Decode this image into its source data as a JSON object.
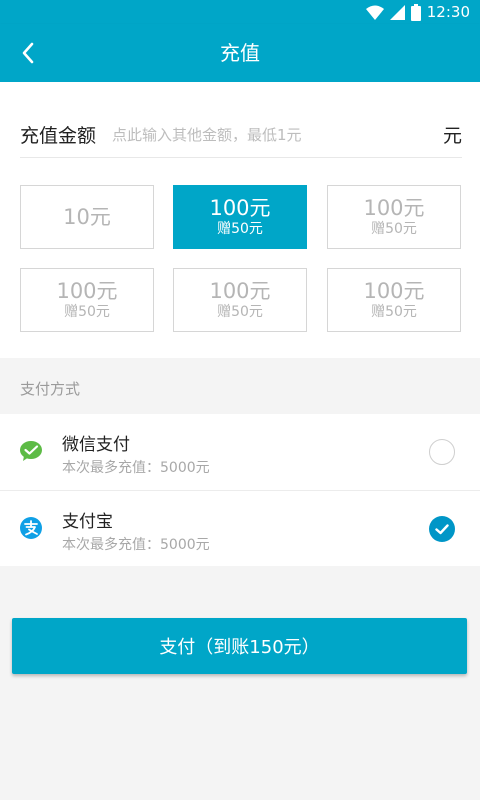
{
  "status_bar": {
    "time": "12:30",
    "icons": [
      "wifi-icon",
      "signal-icon",
      "battery-icon"
    ]
  },
  "app_bar": {
    "title": "充值",
    "back_icon": "chevron-left-icon"
  },
  "amount": {
    "label": "充值金额",
    "placeholder": "点此输入其他金额，最低1元",
    "value": "",
    "unit": "元"
  },
  "options": [
    {
      "amount": "10元",
      "bonus": "",
      "selected": false
    },
    {
      "amount": "100元",
      "bonus": "赠50元",
      "selected": true
    },
    {
      "amount": "100元",
      "bonus": "赠50元",
      "selected": false
    },
    {
      "amount": "100元",
      "bonus": "赠50元",
      "selected": false
    },
    {
      "amount": "100元",
      "bonus": "赠50元",
      "selected": false
    },
    {
      "amount": "100元",
      "bonus": "赠50元",
      "selected": false
    }
  ],
  "payment": {
    "header": "支付方式",
    "methods": [
      {
        "name": "微信支付",
        "desc": "本次最多充值：5000元",
        "icon": "wechat-pay-icon",
        "checked": false
      },
      {
        "name": "支付宝",
        "desc": "本次最多充值：5000元",
        "icon": "alipay-icon",
        "checked": true
      }
    ]
  },
  "submit": {
    "label": "支付（到账150元）"
  },
  "colors": {
    "primary": "#00a6c8",
    "check": "#0096c7",
    "wechat": "#5dbb46",
    "alipay": "#0fa0e6"
  }
}
